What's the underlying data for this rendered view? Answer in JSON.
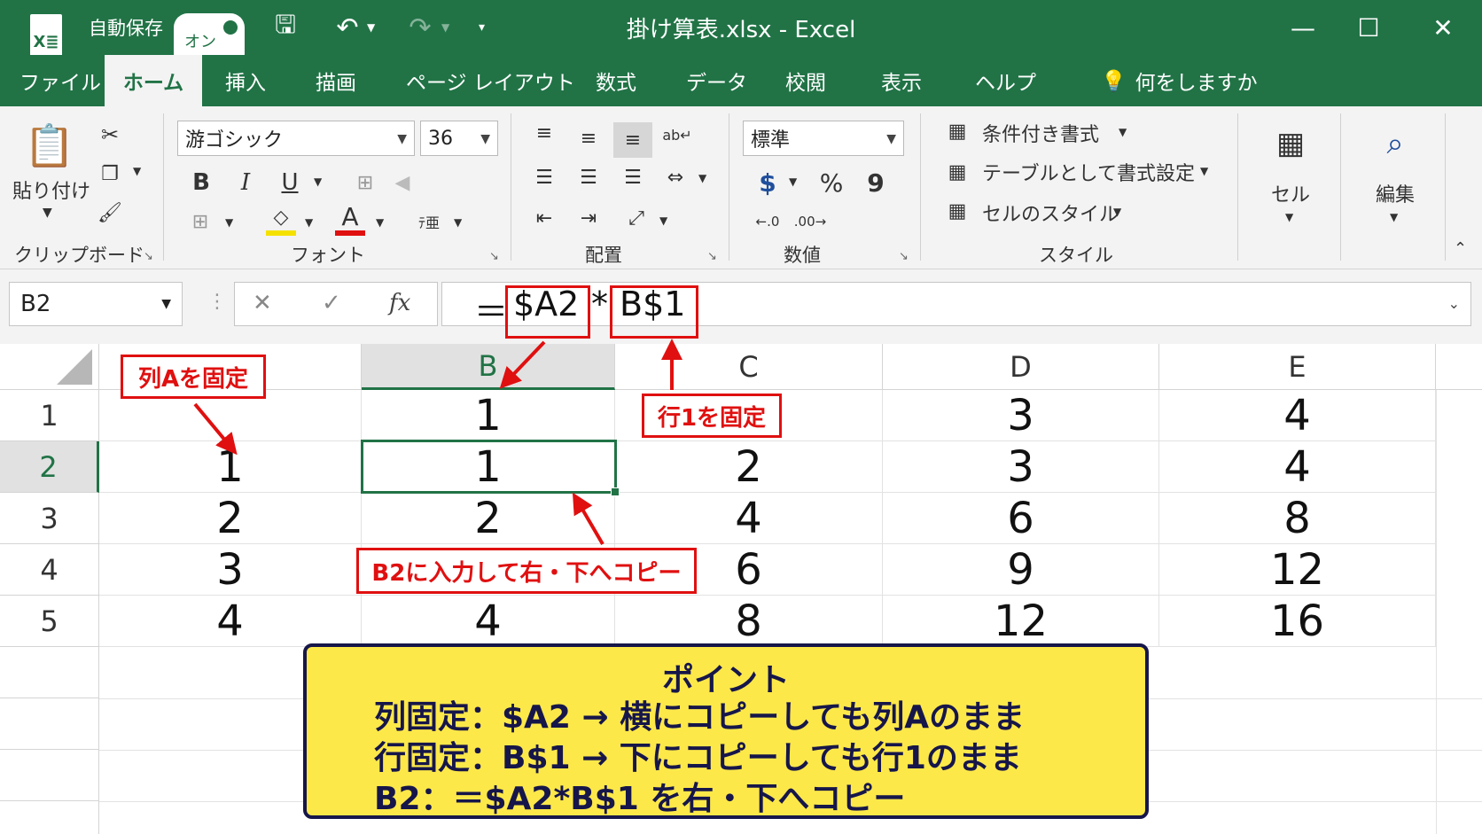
{
  "titlebar": {
    "logo": "X≣",
    "autosave_label": "自動保存",
    "autosave_state": "オン",
    "title": "掛け算表.xlsx  -  Excel",
    "minimize": "—",
    "maximize": "☐",
    "close": "✕"
  },
  "tabs": [
    "ファイル",
    "ホーム",
    "挿入",
    "描画",
    "ページ レイアウト",
    "数式",
    "データ",
    "校閲",
    "表示",
    "ヘルプ"
  ],
  "tell_me": "何をしますか",
  "ribbon": {
    "clipboard": {
      "paste_label": "貼り付け",
      "group": "クリップボード"
    },
    "font": {
      "name": "游ゴシック",
      "size": "36",
      "bold": "B",
      "italic": "I",
      "underline": "U",
      "font_color_letter": "A",
      "group": "フォント"
    },
    "alignment": {
      "group": "配置"
    },
    "number": {
      "format": "標準",
      "currency": "$",
      "percent": "%",
      "comma": "9",
      "group": "数値"
    },
    "styles": {
      "conditional": "条件付き書式",
      "as_table": "テーブルとして書式設定",
      "cell_styles": "セルのスタイル",
      "group": "スタイル"
    },
    "cells": {
      "label": "セル"
    },
    "editing": {
      "label": "編集"
    }
  },
  "formula_bar": {
    "name_box": "B2",
    "cancel": "✕",
    "enter": "✓",
    "fx": "fx",
    "eq": "＝",
    "part1": "$A2",
    "star": "*",
    "part2": "B$1"
  },
  "sheet": {
    "columns": [
      "B",
      "C",
      "D",
      "E"
    ],
    "rows": [
      "1",
      "2",
      "3",
      "4",
      "5"
    ],
    "cells": {
      "A2": "1",
      "A3": "2",
      "A4": "3",
      "A5": "4",
      "B1": "1",
      "B2": "1",
      "B3": "2",
      "B5": "4",
      "C2": "2",
      "C3": "4",
      "C4": "6",
      "C5": "8",
      "D1": "3",
      "D2": "3",
      "D3": "6",
      "D4": "9",
      "D5": "12",
      "E1": "4",
      "E2": "4",
      "E3": "8",
      "E4": "12",
      "E5": "16"
    }
  },
  "annotations": {
    "fix_col": "列Aを固定",
    "fix_row": "行1を固定",
    "copy_hint": "B2に入力して右・下へコピー"
  },
  "point_box": {
    "title": "ポイント",
    "line1": "列固定：$A2 → 横にコピーしても列Aのまま",
    "line2": "行固定：B$1 → 下にコピーしても行1のまま",
    "line3": "B2：＝$A2*B$1  を右・下へコピー"
  },
  "colors": {
    "excel_green": "#217346",
    "red": "#e01010",
    "note_yellow": "#fde84a",
    "navy": "#16164a"
  }
}
